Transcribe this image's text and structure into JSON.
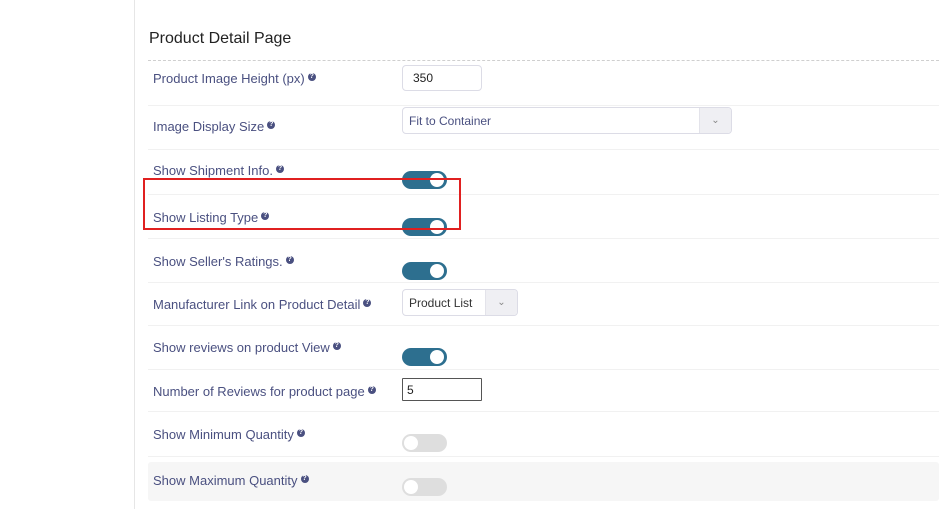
{
  "section": {
    "title": "Product Detail Page"
  },
  "settings": [
    {
      "label": "Product Image Height (px)",
      "type": "text",
      "value": "350"
    },
    {
      "label": "Image Display Size",
      "type": "select",
      "value": "Fit to Container"
    },
    {
      "label": "Show Shipment Info.",
      "type": "toggle",
      "value": true
    },
    {
      "label": "Show Listing Type",
      "type": "toggle",
      "value": true
    },
    {
      "label": "Show Seller's Ratings.",
      "type": "toggle",
      "value": true
    },
    {
      "label": "Manufacturer Link on Product Detail",
      "type": "select",
      "value": "Product List"
    },
    {
      "label": "Show reviews on product View",
      "type": "toggle",
      "value": true
    },
    {
      "label": "Number of Reviews for product page",
      "type": "text",
      "value": "5"
    },
    {
      "label": "Show Minimum Quantity",
      "type": "toggle",
      "value": false
    },
    {
      "label": "Show Maximum Quantity",
      "type": "toggle",
      "value": false
    }
  ],
  "help_glyph": "?",
  "arrow_glyph": "⌄",
  "highlight": {
    "target": "Show Listing Type",
    "color": "#e02020"
  },
  "colors": {
    "toggle_on": "#2d6f8f",
    "toggle_off": "#dedede",
    "label": "#4a5080"
  }
}
